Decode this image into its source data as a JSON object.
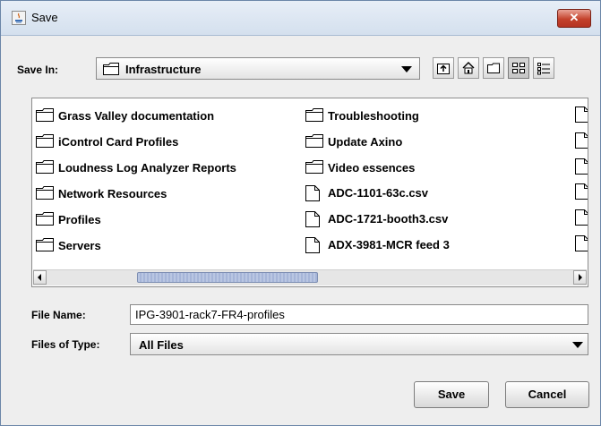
{
  "window": {
    "title": "Save",
    "close_label": "✕"
  },
  "save_in": {
    "label": "Save In:",
    "value": "Infrastructure"
  },
  "toolbar": {
    "buttons": [
      {
        "icon": "up-one-level-icon"
      },
      {
        "icon": "home-icon"
      },
      {
        "icon": "new-folder-icon"
      },
      {
        "icon": "list-view-icon"
      },
      {
        "icon": "details-view-icon"
      }
    ]
  },
  "files": {
    "column1": [
      {
        "name": "Grass Valley documentation",
        "type": "folder"
      },
      {
        "name": "iControl Card Profiles",
        "type": "folder"
      },
      {
        "name": "Loudness Log Analyzer Reports",
        "type": "folder"
      },
      {
        "name": "Network Resources",
        "type": "folder"
      },
      {
        "name": "Profiles",
        "type": "folder"
      },
      {
        "name": "Servers",
        "type": "folder"
      }
    ],
    "column2": [
      {
        "name": "Troubleshooting",
        "type": "folder"
      },
      {
        "name": "Update Axino",
        "type": "folder"
      },
      {
        "name": "Video essences",
        "type": "folder"
      },
      {
        "name": "ADC-1101-63c.csv",
        "type": "file"
      },
      {
        "name": "ADC-1721-booth3.csv",
        "type": "file"
      },
      {
        "name": "ADX-3981-MCR feed 3",
        "type": "file"
      }
    ]
  },
  "file_name": {
    "label": "File Name:",
    "value": "IPG-3901-rack7-FR4-profiles"
  },
  "file_type": {
    "label": "Files of Type:",
    "value": "All Files"
  },
  "buttons": {
    "save": "Save",
    "cancel": "Cancel"
  },
  "colors": {
    "title_bar": "#d9e4f1",
    "close_button": "#c4422c",
    "scroll_thumb": "#b0bedd"
  }
}
